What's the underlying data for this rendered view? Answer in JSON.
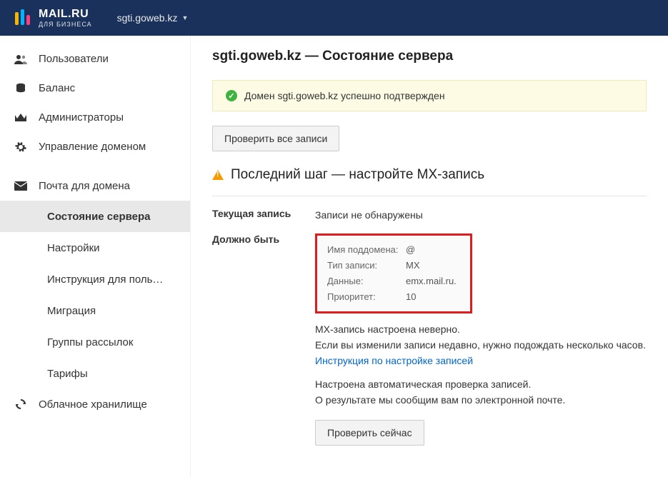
{
  "brand": {
    "main": "MAIL.RU",
    "sub": "ДЛЯ БИЗНЕСА"
  },
  "header": {
    "domain": "sgti.goweb.kz"
  },
  "sidebar": {
    "items": [
      {
        "label": "Пользователи"
      },
      {
        "label": "Баланс"
      },
      {
        "label": "Администраторы"
      },
      {
        "label": "Управление доменом"
      },
      {
        "label": "Почта для домена"
      },
      {
        "label": "Облачное хранилище"
      }
    ],
    "subs": [
      {
        "label": "Состояние сервера"
      },
      {
        "label": "Настройки"
      },
      {
        "label": "Инструкция для поль…"
      },
      {
        "label": "Миграция"
      },
      {
        "label": "Группы рассылок"
      },
      {
        "label": "Тарифы"
      }
    ]
  },
  "main": {
    "title": "sgti.goweb.kz — Состояние сервера",
    "success": "Домен sgti.goweb.kz успешно подтвержден",
    "check_all_btn": "Проверить все записи",
    "step_title": "Последний шаг — настройте MX-запись",
    "current_label": "Текущая запись",
    "current_value": "Записи не обнаружены",
    "should_label": "Должно быть",
    "mx": {
      "k1": "Имя поддомена:",
      "v1": "@",
      "k2": "Тип записи:",
      "v2": "MX",
      "k3": "Данные:",
      "v3": "emx.mail.ru.",
      "k4": "Приоритет:",
      "v4": "10"
    },
    "note1": "MX-запись настроена неверно.",
    "note2": "Если вы изменили записи недавно, нужно подождать несколько часов.",
    "link": "Инструкция по настройке записей",
    "auto1": "Настроена автоматическая проверка записей.",
    "auto2": "О результате мы сообщим вам по электронной почте.",
    "check_now_btn": "Проверить сейчас"
  }
}
